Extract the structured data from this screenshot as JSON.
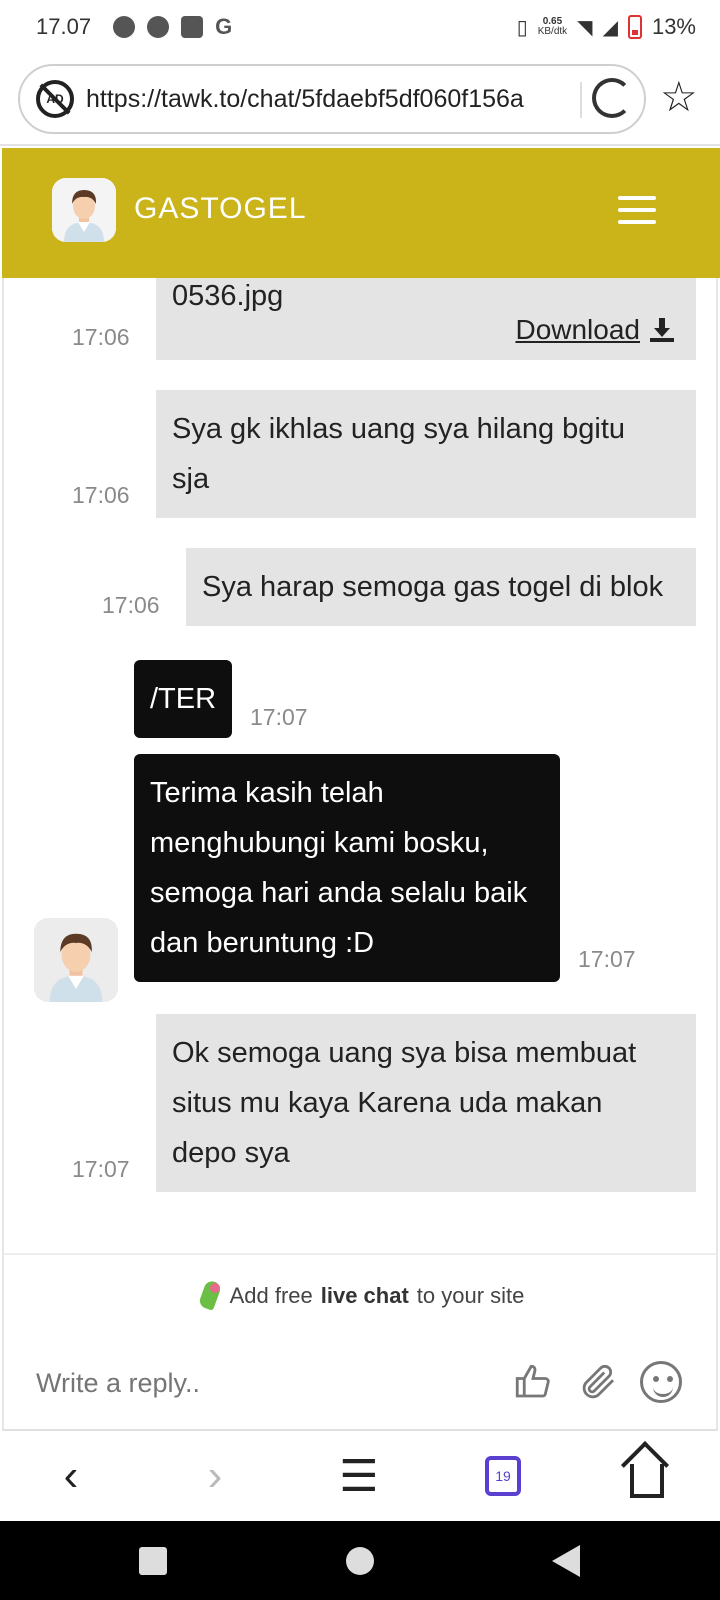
{
  "status_bar": {
    "time": "17.07",
    "net_speed_value": "0.65",
    "net_speed_unit": "KB/dtk",
    "battery": "13%"
  },
  "browser": {
    "url": "https://tawk.to/chat/5fdaebf5df060f156a",
    "tab_count": "19"
  },
  "chat_header": {
    "title": "GASTOGEL"
  },
  "messages": [
    {
      "sender": "visitor",
      "text": "0536.jpg",
      "download_label": "Download",
      "time": "17:06"
    },
    {
      "sender": "visitor",
      "text_line1": "Sya gk ikhlas uang sya hilang bgitu",
      "text_line2": "sja",
      "time": "17:06"
    },
    {
      "sender": "visitor",
      "text": "Sya harap semoga gas togel di blok",
      "time": "17:06"
    },
    {
      "sender": "agent",
      "text": "/TER",
      "time": "17:07"
    },
    {
      "sender": "agent",
      "text_line1": "Terima kasih telah",
      "text_line2": "menghubungi kami bosku,",
      "text_line3": "semoga hari anda selalu baik",
      "text_line4": "dan beruntung :D",
      "time": "17:07"
    },
    {
      "sender": "visitor",
      "text_line1": "Ok semoga uang sya bisa membuat",
      "text_line2": "situs mu kaya Karena uda makan",
      "text_line3": "depo sya",
      "time": "17:07"
    }
  ],
  "branding": {
    "prefix": "Add free",
    "bold": "live chat",
    "suffix": "to your site"
  },
  "reply": {
    "placeholder": "Write a reply.."
  },
  "colors": {
    "header": "#cbb31a",
    "agent_bubble": "#0e0e0e",
    "visitor_bubble": "#e4e4e4",
    "tab_accent": "#5b3fd1"
  },
  "icons": [
    "chrome-icon",
    "messenger-icon",
    "mail-icon",
    "google-icon",
    "vibrate-icon",
    "wifi-icon",
    "signal-icon",
    "battery-icon",
    "adblock-icon",
    "reload-icon",
    "star-icon",
    "menu-icon",
    "download-icon",
    "parrot-icon",
    "like-icon",
    "attach-icon",
    "emoji-icon",
    "back-icon",
    "forward-icon",
    "tabs-icon",
    "home-icon"
  ]
}
